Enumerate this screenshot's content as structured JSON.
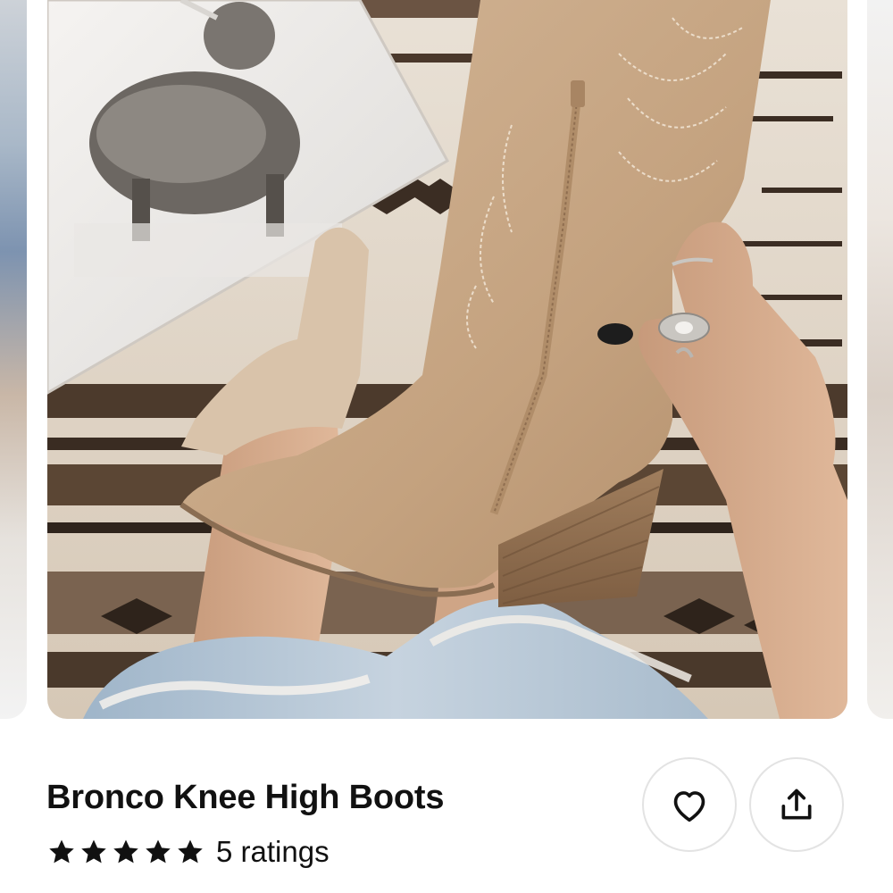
{
  "product": {
    "title": "Bronco Knee High Boots",
    "rating_stars": 5,
    "ratings_label": "5 ratings"
  },
  "icons": {
    "favorite": "heart-icon",
    "share": "share-icon",
    "star": "star-icon"
  },
  "colors": {
    "text": "#111111",
    "button_border": "#e3e3e3"
  }
}
